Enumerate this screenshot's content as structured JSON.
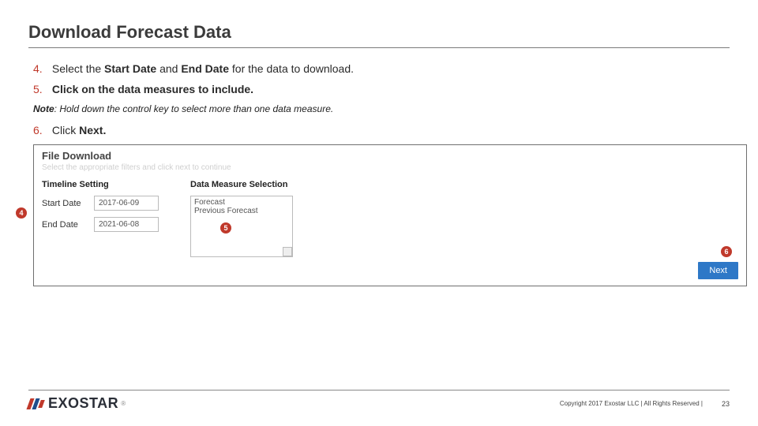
{
  "title": "Download Forecast Data",
  "steps": {
    "s4": {
      "num": "4.",
      "pre": "Select the ",
      "bold1": "Start Date ",
      "mid": "and ",
      "bold2": "End Date ",
      "post": "for the data to download."
    },
    "s5": {
      "num": "5.",
      "text": "Click on the data measures to include."
    },
    "s6": {
      "num": "6.",
      "pre": "Click ",
      "bold": "Next."
    }
  },
  "note": {
    "label": "Note",
    "text": ": Hold down the control key to select more than one data measure."
  },
  "shot": {
    "title": "File Download",
    "subtitle": "Select the appropriate filters and click next to continue",
    "timeline_heading": "Timeline Setting",
    "measure_heading": "Data Measure Selection",
    "start_label": "Start Date",
    "start_value": "2017-06-09",
    "end_label": "End Date",
    "end_value": "2021-06-08",
    "opt1": "Forecast",
    "opt2": "Previous Forecast",
    "next": "Next"
  },
  "badges": {
    "b4": "4",
    "b5": "5",
    "b6": "6"
  },
  "footer": {
    "logo": "EXOSTAR",
    "reg": "®",
    "copy": "Copyright 2017 Exostar LLC | All Rights Reserved |",
    "page": "23"
  }
}
